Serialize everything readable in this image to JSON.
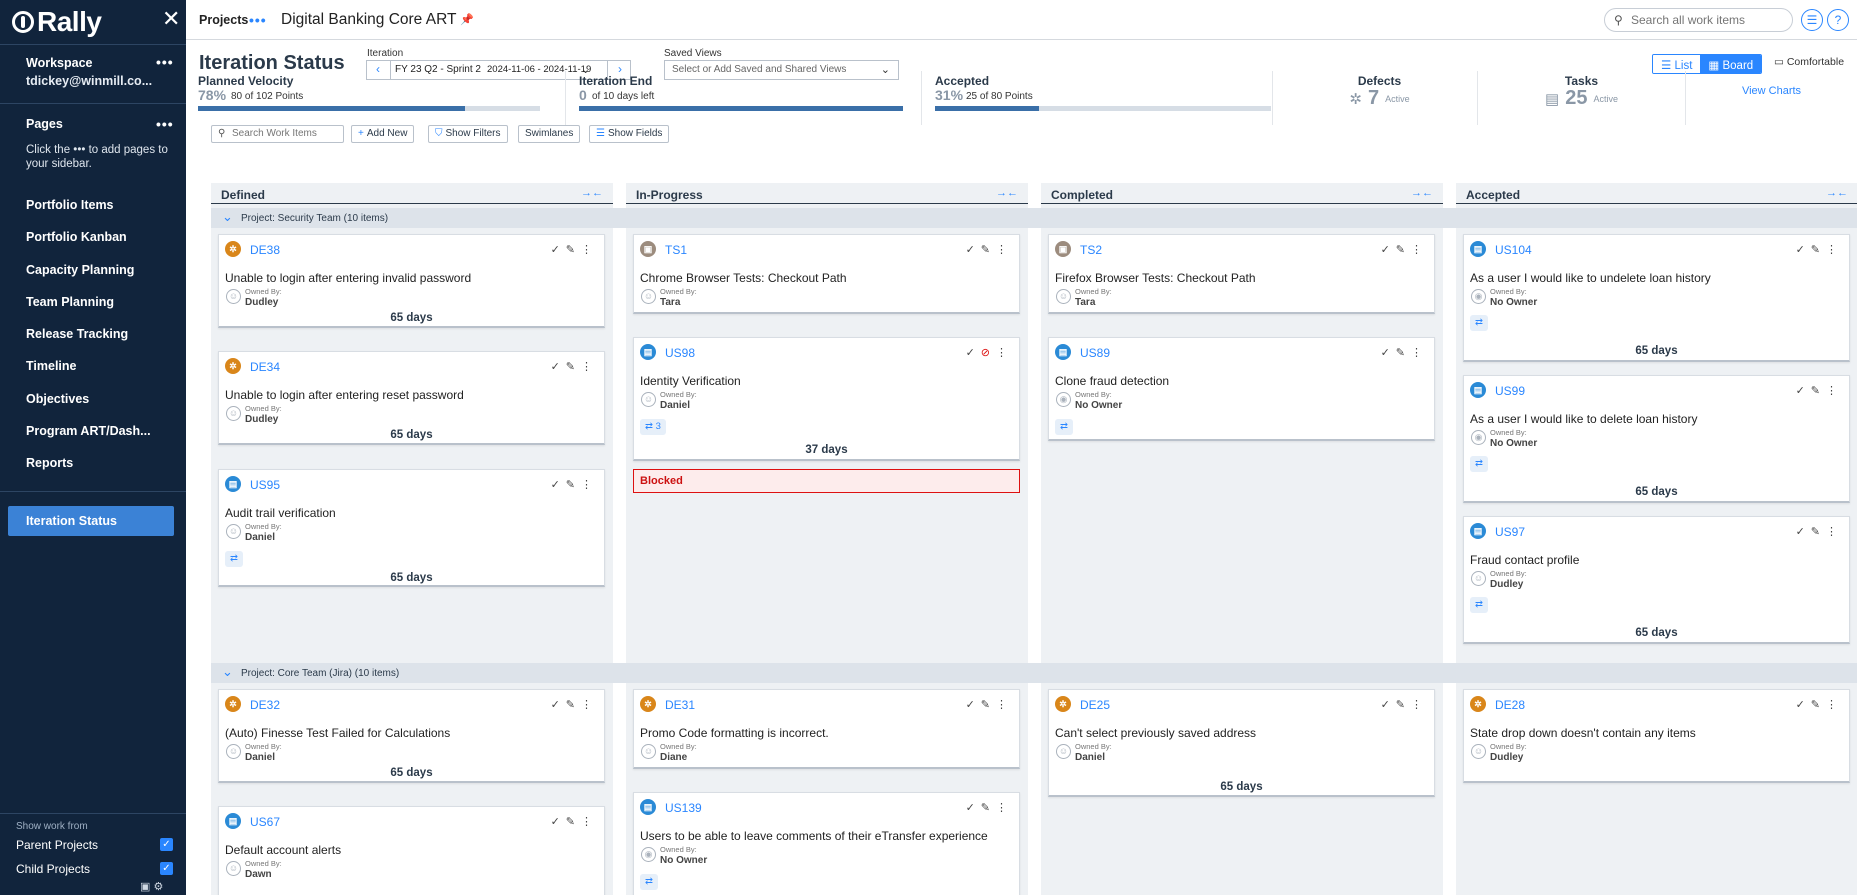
{
  "sidebar": {
    "logo": "Rally",
    "workspace_label": "Workspace",
    "user": "tdickey@winmill.co...",
    "pages_label": "Pages",
    "hint": "Click the ••• to add pages to your sidebar.",
    "nav": [
      "Portfolio Items",
      "Portfolio Kanban",
      "Capacity Planning",
      "Team Planning",
      "Release Tracking",
      "Timeline",
      "Objectives",
      "Program ART/Dash...",
      "Reports"
    ],
    "active": "Iteration Status",
    "show_work_from": "Show work from",
    "parent_projects": "Parent Projects",
    "child_projects": "Child Projects"
  },
  "topbar": {
    "projects": "Projects",
    "title": "Digital Banking Core ART",
    "search_placeholder": "Search all work items"
  },
  "page": {
    "title": "Iteration Status",
    "iteration_label": "Iteration",
    "iteration_name": "FY 23 Q2 - Sprint 2",
    "iteration_dates": "2024-11-06 - 2024-11-19",
    "saved_views_label": "Saved Views",
    "saved_views_placeholder": "Select or Add Saved and Shared Views",
    "list_label": "List",
    "board_label": "Board",
    "comfortable_label": "Comfortable"
  },
  "stats": {
    "planned": {
      "label": "Planned Velocity",
      "pct": "78%",
      "sub": "80 of 102 Points",
      "progress": 0.78
    },
    "iteration_end": {
      "label": "Iteration End",
      "num": "0",
      "sub": "of 10 days left",
      "progress": 1.0
    },
    "accepted": {
      "label": "Accepted",
      "pct": "31%",
      "sub": "25 of 80 Points",
      "progress": 0.31
    },
    "defects": {
      "label": "Defects",
      "num": "7",
      "sub": "Active"
    },
    "tasks": {
      "label": "Tasks",
      "num": "25",
      "sub": "Active"
    },
    "view_charts": "View Charts"
  },
  "toolbar": {
    "search_placeholder": "Search Work Items",
    "add_new": "Add New",
    "show_filters": "Show Filters",
    "swimlanes": "Swimlanes",
    "show_fields": "Show Fields"
  },
  "columns": [
    "Defined",
    "In-Progress",
    "Completed",
    "Accepted"
  ],
  "swimlanes": [
    {
      "label": "Project: Security Team  (10 items)"
    },
    {
      "label": "Project: Core Team (Jira)  (10 items)"
    }
  ],
  "cards": {
    "de38": {
      "id": "DE38",
      "name": "Unable to login after entering invalid password",
      "owned_by": "Owned By:",
      "owner": "Dudley",
      "days": "65 days"
    },
    "de34": {
      "id": "DE34",
      "name": "Unable to login after entering reset password",
      "owned_by": "Owned By:",
      "owner": "Dudley",
      "days": "65 days"
    },
    "us95": {
      "id": "US95",
      "name": "Audit trail verification",
      "owned_by": "Owned By:",
      "owner": "Daniel",
      "days": "65 days"
    },
    "ts1": {
      "id": "TS1",
      "name": "Chrome Browser Tests: Checkout Path",
      "owned_by": "Owned By:",
      "owner": "Tara"
    },
    "us98": {
      "id": "US98",
      "name": "Identity Verification",
      "owned_by": "Owned By:",
      "owner": "Daniel",
      "tasks": "3",
      "days": "37 days",
      "blocked": "Blocked"
    },
    "ts2": {
      "id": "TS2",
      "name": "Firefox Browser Tests: Checkout Path",
      "owned_by": "Owned By:",
      "owner": "Tara"
    },
    "us89": {
      "id": "US89",
      "name": "Clone fraud detection",
      "owned_by": "Owned By:",
      "owner": "No Owner"
    },
    "us104": {
      "id": "US104",
      "name": "As a user I would like to undelete loan history",
      "owned_by": "Owned By:",
      "owner": "No Owner",
      "days": "65 days"
    },
    "us99": {
      "id": "US99",
      "name": "As a user I would like to delete loan history",
      "owned_by": "Owned By:",
      "owner": "No Owner",
      "days": "65 days"
    },
    "us97": {
      "id": "US97",
      "name": "Fraud contact profile",
      "owned_by": "Owned By:",
      "owner": "Dudley",
      "days": "65 days"
    },
    "de32": {
      "id": "DE32",
      "name": "(Auto) Finesse Test Failed for Calculations",
      "owned_by": "Owned By:",
      "owner": "Daniel",
      "days": "65 days"
    },
    "us67": {
      "id": "US67",
      "name": "Default account alerts",
      "owned_by": "Owned By:",
      "owner": "Dawn"
    },
    "de31": {
      "id": "DE31",
      "name": "Promo Code formatting is incorrect.",
      "owned_by": "Owned By:",
      "owner": "Diane"
    },
    "us139": {
      "id": "US139",
      "name": "Users to be able to leave comments of their eTransfer experience",
      "owned_by": "Owned By:",
      "owner": "No Owner"
    },
    "de25": {
      "id": "DE25",
      "name": "Can't select previously saved address",
      "owned_by": "Owned By:",
      "owner": "Daniel",
      "days": "65 days"
    },
    "de28": {
      "id": "DE28",
      "name": "State drop down doesn't contain any items",
      "owned_by": "Owned By:",
      "owner": "Dudley"
    }
  },
  "colors": {
    "sidebar": "#11243c",
    "accent": "#2a86ff",
    "active_nav": "#3b82d6",
    "defect": "#d9861a",
    "story": "#2a8ad6",
    "blocked": "#dd1111"
  }
}
